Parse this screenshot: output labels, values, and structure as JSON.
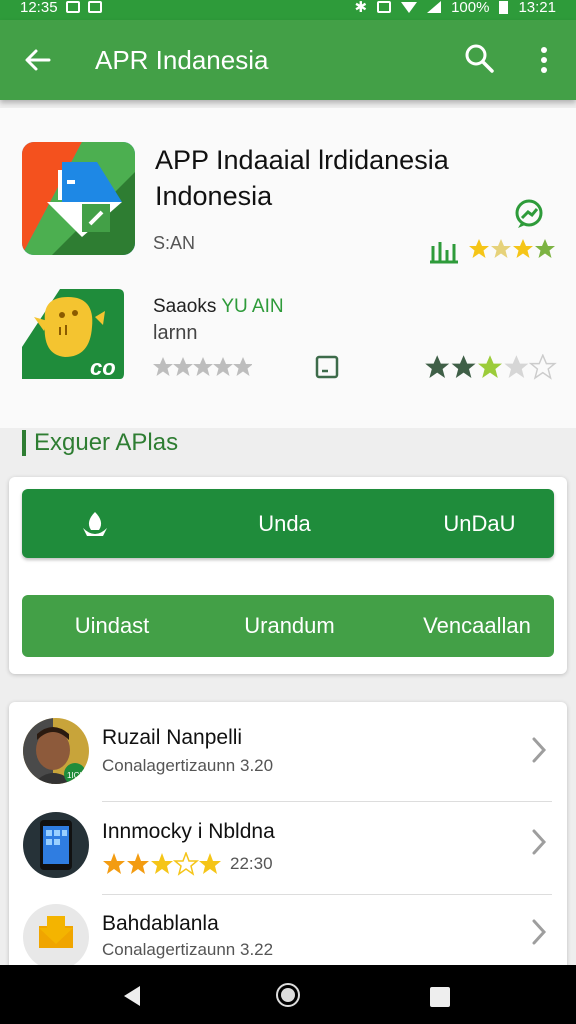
{
  "status_bar": {
    "time": "12:35",
    "battery": "100%",
    "clock_right": "13:21"
  },
  "app_bar": {
    "title": "APR Indanesia"
  },
  "featured": [
    {
      "title": "APP Indaaial lrdidanesia Indonesia",
      "subtitle": "S:AN",
      "rating": 4
    },
    {
      "title_prefix": "Saaoks ",
      "title_highlight": "YU AIN",
      "subtitle": "larnn",
      "rating": 3
    }
  ],
  "section_title": "Exguer APlas",
  "actions": {
    "row1": {
      "b1": "",
      "b2": "Unda",
      "b3": "UnDaU"
    },
    "row2": {
      "b1": "Uindast",
      "b2": "Urandum",
      "b3": "Vencaallan"
    }
  },
  "list": [
    {
      "title": "Ruzail Nanpelli",
      "subtitle": "Conalagertizaunn 3.20",
      "badge": "1ICH"
    },
    {
      "title": "Innmocky i Nbldna",
      "subtitle": "22:30",
      "rating": 3.5
    },
    {
      "title": "Bahdablanla",
      "subtitle": "Conalagertizaunn 3.22"
    }
  ],
  "colors": {
    "primary": "#43a047",
    "primary_dark": "#1f8c3b",
    "star": "#f5c518",
    "star_empty": "#bdbdbd"
  }
}
